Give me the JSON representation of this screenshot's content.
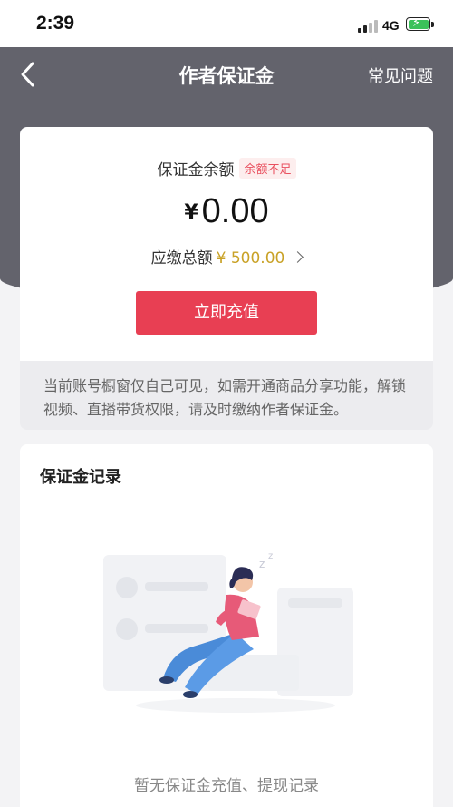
{
  "status_bar": {
    "time": "2:39",
    "network": "4G"
  },
  "header": {
    "title": "作者保证金",
    "faq_label": "常见问题"
  },
  "balance": {
    "label": "保证金余额",
    "badge": "余额不足",
    "currency_symbol": "¥",
    "amount": "0.00",
    "due_label": "应缴总额",
    "due_amount": "¥ 500.00",
    "recharge_label": "立即充值"
  },
  "notice": {
    "text": "当前账号橱窗仅自己可见，如需开通商品分享功能，解锁视频、直播带货权限，请及时缴纳作者保证金。"
  },
  "records": {
    "title": "保证金记录",
    "empty_text": "暂无保证金充值、提现记录"
  },
  "colors": {
    "header_bg": "#63636c",
    "accent_red": "#e83f53",
    "gold": "#c9a227"
  },
  "icons": {
    "back": "chevron-left-icon",
    "due_arrow": "chevron-right-icon"
  }
}
